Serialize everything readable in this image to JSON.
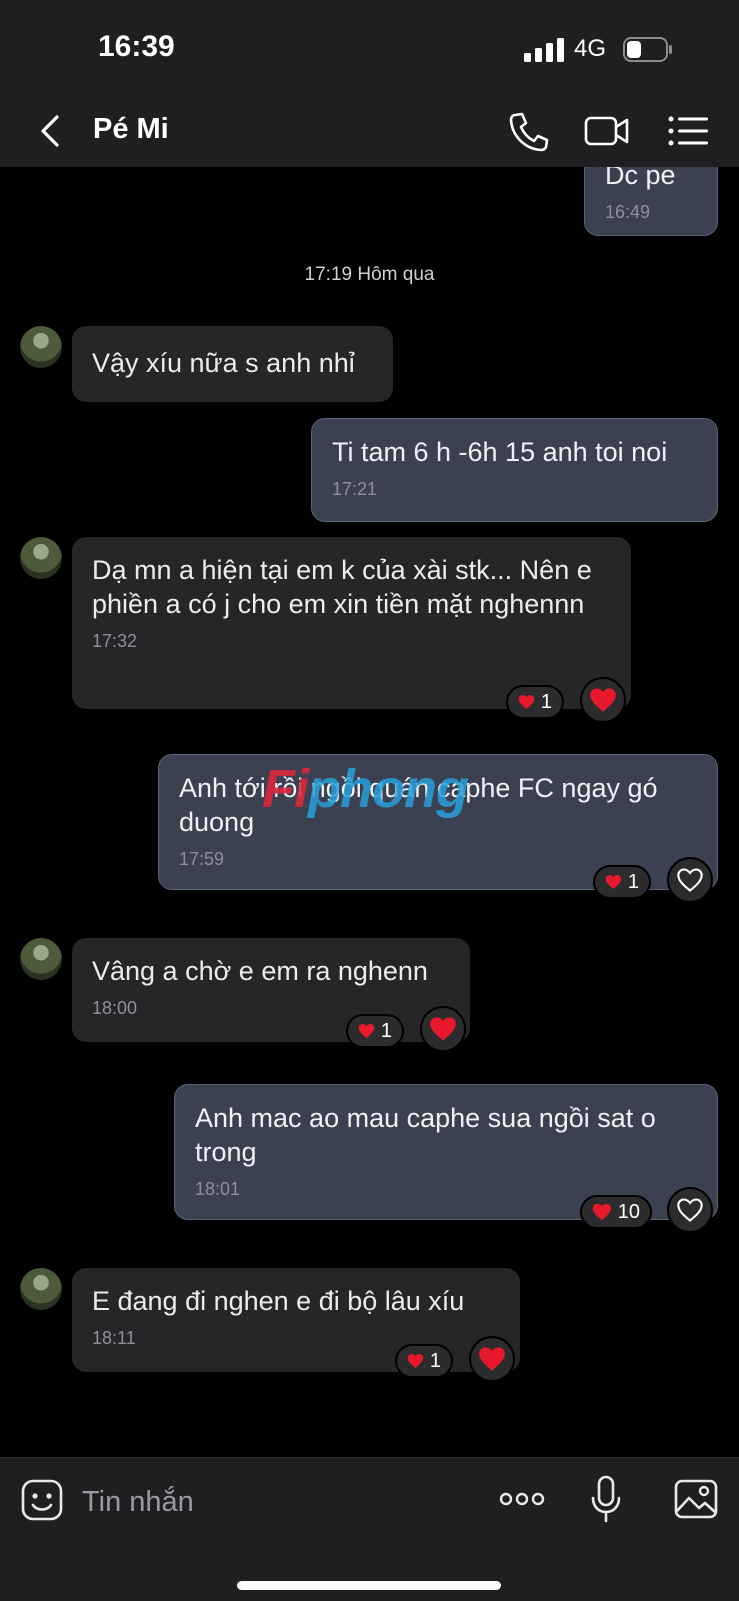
{
  "status": {
    "time": "16:39",
    "network": "4G"
  },
  "header": {
    "title": "Pé Mi"
  },
  "chat": {
    "partial_message": {
      "text": "Dc pe",
      "time": "16:49"
    },
    "day_separator": "17:19 Hôm qua",
    "messages": [
      {
        "dir": "in",
        "text": "Vậy xíu nữa s anh nhỉ",
        "time": ""
      },
      {
        "dir": "out",
        "text": "Ti tam 6 h -6h 15 anh toi noi",
        "time": "17:21"
      },
      {
        "dir": "in",
        "text": "Dạ mn a hiện tại em k của xài stk... Nên e phiền a có j cho em xin tiền mặt nghennn",
        "time": "17:32",
        "reaction_count": "1"
      },
      {
        "dir": "out",
        "text": "Anh tới rồi ngồi quán caphe FC ngay gó duong",
        "time": "17:59",
        "reaction_count": "1"
      },
      {
        "dir": "in",
        "text": "Vâng a chờ e em ra nghenn",
        "time": "18:00",
        "reaction_count": "1"
      },
      {
        "dir": "out",
        "text": "Anh mac ao mau caphe sua ngồi sat o trong",
        "time": "18:01",
        "reaction_count": "10"
      },
      {
        "dir": "in",
        "text": "E đang đi nghen e đi bộ lâu xíu",
        "time": "18:11",
        "reaction_count": "1"
      }
    ]
  },
  "watermark": {
    "text_a": "Fi",
    "text_b": "phong"
  },
  "input": {
    "placeholder": "Tin nhắn"
  },
  "colors": {
    "heart": "#e8192c",
    "incoming": "#262628",
    "outgoing": "#3b4150",
    "bar": "#1f1f21"
  }
}
